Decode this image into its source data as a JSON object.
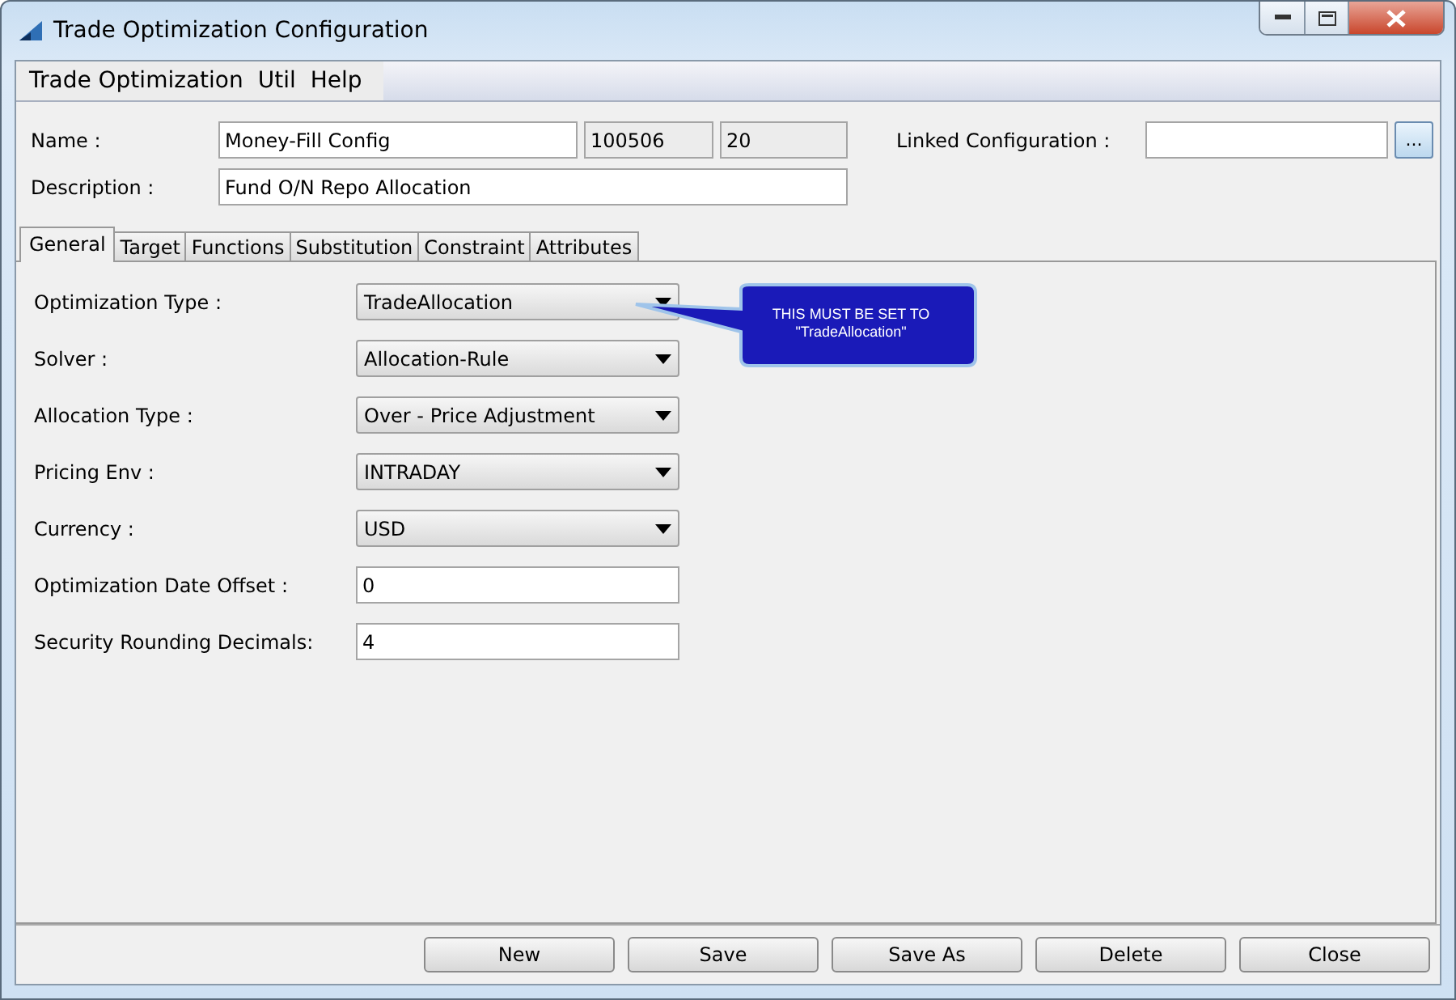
{
  "window": {
    "title": "Trade Optimization Configuration"
  },
  "menu": [
    "Trade Optimization",
    "Util",
    "Help"
  ],
  "header": {
    "name_label": "Name :",
    "name_value": "Money-Fill Config",
    "id_value": "100506",
    "version_value": "20",
    "linked_label": "Linked Configuration :",
    "browse_button": "...",
    "description_label": "Description :",
    "description_value": "Fund O/N Repo Allocation"
  },
  "tabs": [
    {
      "label": "General",
      "selected": true
    },
    {
      "label": "Target",
      "selected": false
    },
    {
      "label": "Functions",
      "selected": false
    },
    {
      "label": "Substitution",
      "selected": false
    },
    {
      "label": "Constraint",
      "selected": false
    },
    {
      "label": "Attributes",
      "selected": false
    }
  ],
  "fields": [
    {
      "label": "Optimization Type :",
      "kind": "dropdown",
      "value": "TradeAllocation"
    },
    {
      "label": "Solver :",
      "kind": "dropdown",
      "value": "Allocation-Rule"
    },
    {
      "label": "Allocation Type :",
      "kind": "dropdown",
      "value": "Over - Price Adjustment"
    },
    {
      "label": "Pricing Env :",
      "kind": "dropdown",
      "value": "INTRADAY"
    },
    {
      "label": "Currency :",
      "kind": "dropdown",
      "value": "USD"
    },
    {
      "label": "Optimization Date Offset :",
      "kind": "text",
      "value": "0"
    },
    {
      "label": "Security Rounding Decimals:",
      "kind": "text",
      "value": "4"
    }
  ],
  "callout": {
    "lines": [
      "THIS MUST BE SET TO",
      "\"TradeAllocation\""
    ]
  },
  "buttons": [
    "New",
    "Save",
    "Save As",
    "Delete",
    "Close"
  ]
}
